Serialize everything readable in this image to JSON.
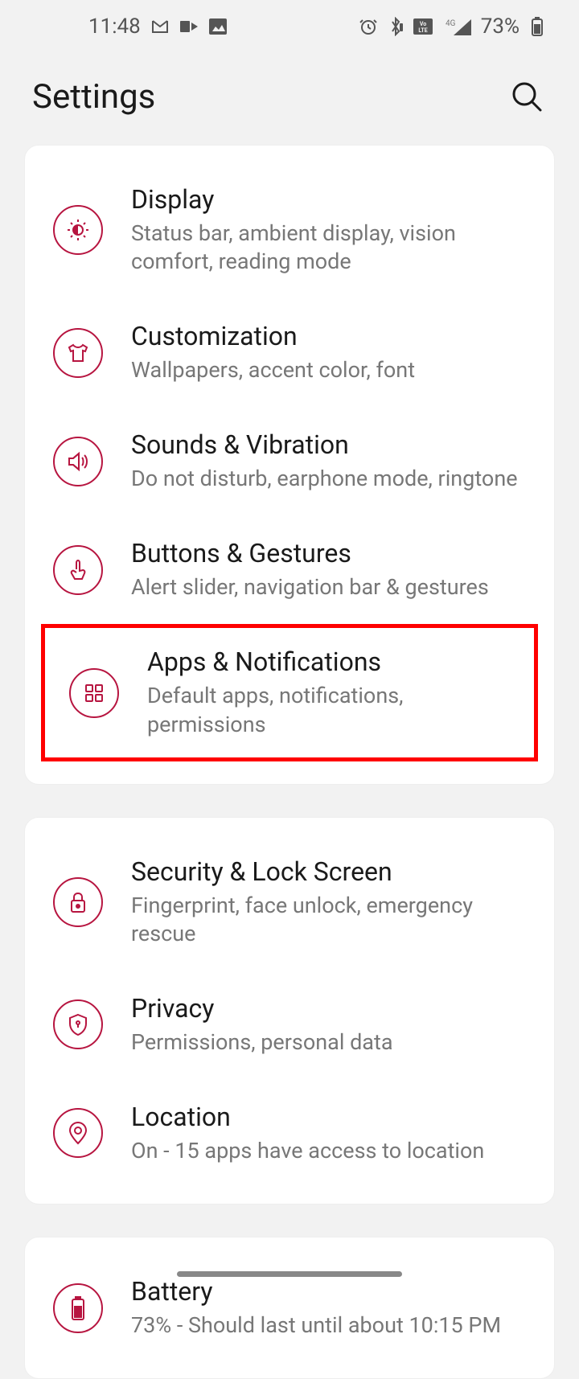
{
  "status_bar": {
    "time": "11:48",
    "battery_percent": "73%"
  },
  "header": {
    "title": "Settings"
  },
  "groups": [
    {
      "items": [
        {
          "title": "Display",
          "subtitle": "Status bar, ambient display, vision comfort, reading mode",
          "highlighted": false
        },
        {
          "title": "Customization",
          "subtitle": "Wallpapers, accent color, font",
          "highlighted": false
        },
        {
          "title": "Sounds & Vibration",
          "subtitle": "Do not disturb, earphone mode, ringtone",
          "highlighted": false
        },
        {
          "title": "Buttons & Gestures",
          "subtitle": "Alert slider, navigation bar & gestures",
          "highlighted": false
        },
        {
          "title": "Apps & Notifications",
          "subtitle": "Default apps, notifications, permissions",
          "highlighted": true
        }
      ]
    },
    {
      "items": [
        {
          "title": "Security & Lock Screen",
          "subtitle": "Fingerprint, face unlock, emergency rescue",
          "highlighted": false
        },
        {
          "title": "Privacy",
          "subtitle": "Permissions, personal data",
          "highlighted": false
        },
        {
          "title": "Location",
          "subtitle": "On - 15 apps have access to location",
          "highlighted": false
        }
      ]
    },
    {
      "items": [
        {
          "title": "Battery",
          "subtitle": "73% - Should last until about 10:15 PM",
          "highlighted": false
        }
      ]
    }
  ]
}
